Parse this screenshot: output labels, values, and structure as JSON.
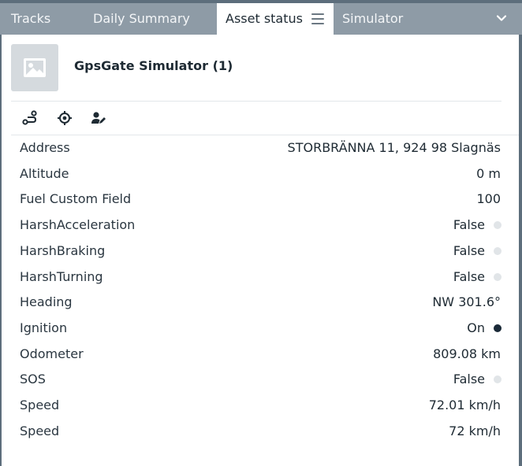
{
  "tabs": [
    {
      "label": "Tracks"
    },
    {
      "label": "Daily Summary"
    },
    {
      "label": "Asset status"
    },
    {
      "label": "Simulator"
    }
  ],
  "asset": {
    "name": "GpsGate Simulator (1)"
  },
  "toolbar": {
    "icons": [
      "route-icon",
      "locate-icon",
      "assign-user-icon"
    ]
  },
  "fields": [
    {
      "label": "Address",
      "value": "STORBRÄNNA 11, 924 98 Slagnäs"
    },
    {
      "label": "Altitude",
      "value": "0 m"
    },
    {
      "label": "Fuel Custom Field",
      "value": "100"
    },
    {
      "label": "HarshAcceleration",
      "value": "False",
      "indicator": "off"
    },
    {
      "label": "HarshBraking",
      "value": "False",
      "indicator": "off"
    },
    {
      "label": "HarshTurning",
      "value": "False",
      "indicator": "off"
    },
    {
      "label": "Heading",
      "value": "NW 301.6°"
    },
    {
      "label": "Ignition",
      "value": "On",
      "indicator": "on"
    },
    {
      "label": "Odometer",
      "value": "809.08 km"
    },
    {
      "label": "SOS",
      "value": "False",
      "indicator": "off"
    },
    {
      "label": "Speed",
      "value": "72.01 km/h"
    },
    {
      "label": "Speed",
      "value": "72 km/h"
    }
  ],
  "colors": {
    "tabbar": "#5d6e7c",
    "tab_inactive": "#8e9ba6",
    "indicator_on": "#1b2a38",
    "indicator_off": "#e1e5e8"
  }
}
